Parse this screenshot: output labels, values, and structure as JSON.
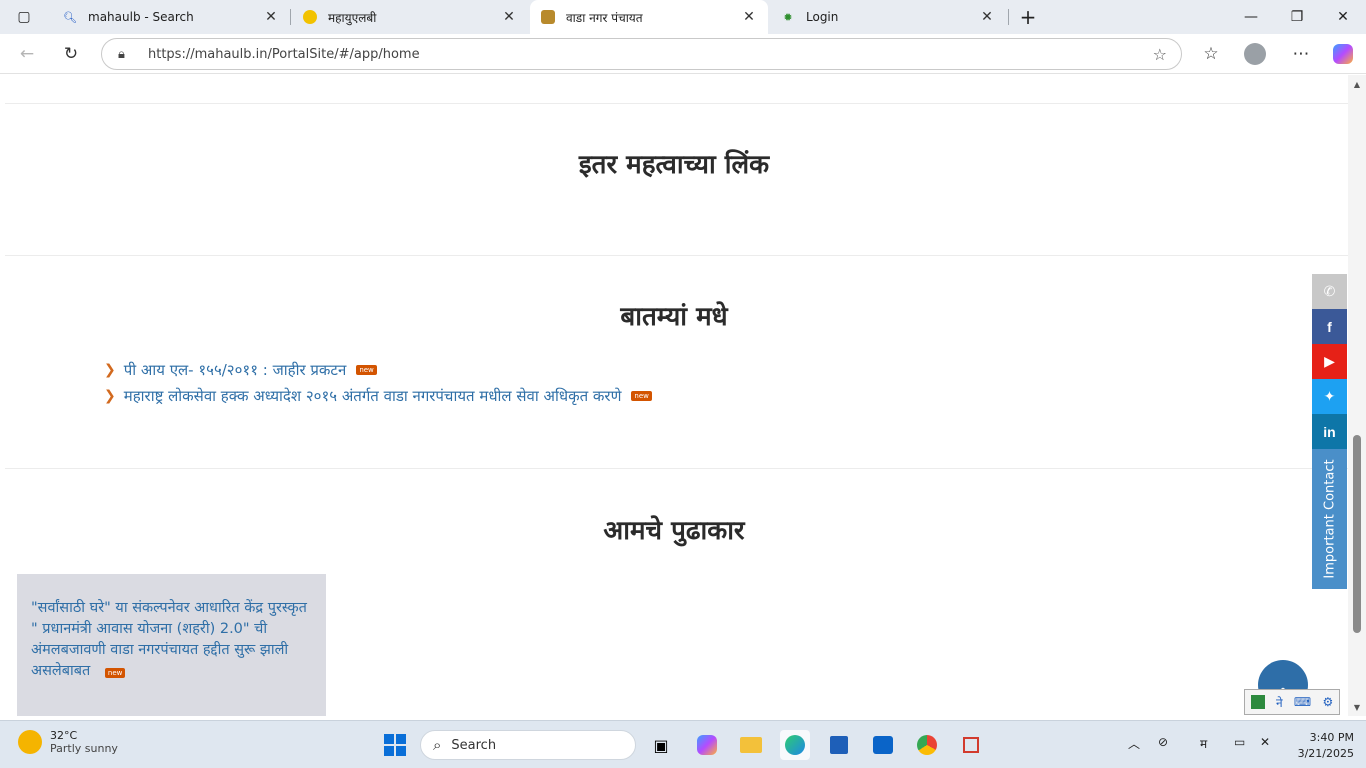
{
  "browser": {
    "tabs": [
      {
        "title": "mahaulb - Search",
        "icon": "search-icon",
        "active": false
      },
      {
        "title": "महायुएलबी",
        "icon": "site-logo-icon",
        "active": false
      },
      {
        "title": "वाडा नगर पंचायत",
        "icon": "site-logo-icon",
        "active": true
      },
      {
        "title": "Login",
        "icon": "gear-logo-icon",
        "active": false
      }
    ],
    "new_tab_label": "+",
    "url": "https://mahaulb.in/PortalSite/#/app/home"
  },
  "page": {
    "sections": {
      "links_title": "इतर महत्वाच्या लिंक",
      "news_title": "बातम्यां मधे",
      "leaders_title": "आमचे पुढाकार"
    },
    "news": [
      {
        "text": "पी आय एल- १५५/२०११ : जाहीर प्रकटन",
        "badge": "new"
      },
      {
        "text": "महाराष्ट्र लोकसेवा हक्क अध्यादेश २०१५ अंतर्गत वाडा नगरपंचायत मधील सेवा अधिकृत करणे",
        "badge": "new"
      }
    ],
    "notice": {
      "text": "\"सर्वांसाठी घरे\" या संकल्पनेवर आधारित केंद्र पुरस्कृत \" प्रधानमंत्री आवास योजना (शहरी) 2.0\" ची अंमलबजावणी वाडा नगरपंचायत हद्दीत सुरू झाली असलेबाबत",
      "badge": "new"
    },
    "sidebar": {
      "important_contact": "Important Contact",
      "colors": {
        "phone": "#c8c8c8",
        "facebook": "#3b5998",
        "youtube": "#e62117",
        "twitter": "#1da1f2",
        "linkedin": "#0e76a8"
      }
    },
    "ime_widget_label": "ने"
  },
  "taskbar": {
    "weather_temp": "32°C",
    "weather_desc": "Partly sunny",
    "search_placeholder": "Search",
    "tray_lang": "म",
    "time": "3:40 PM",
    "date": "3/21/2025"
  }
}
